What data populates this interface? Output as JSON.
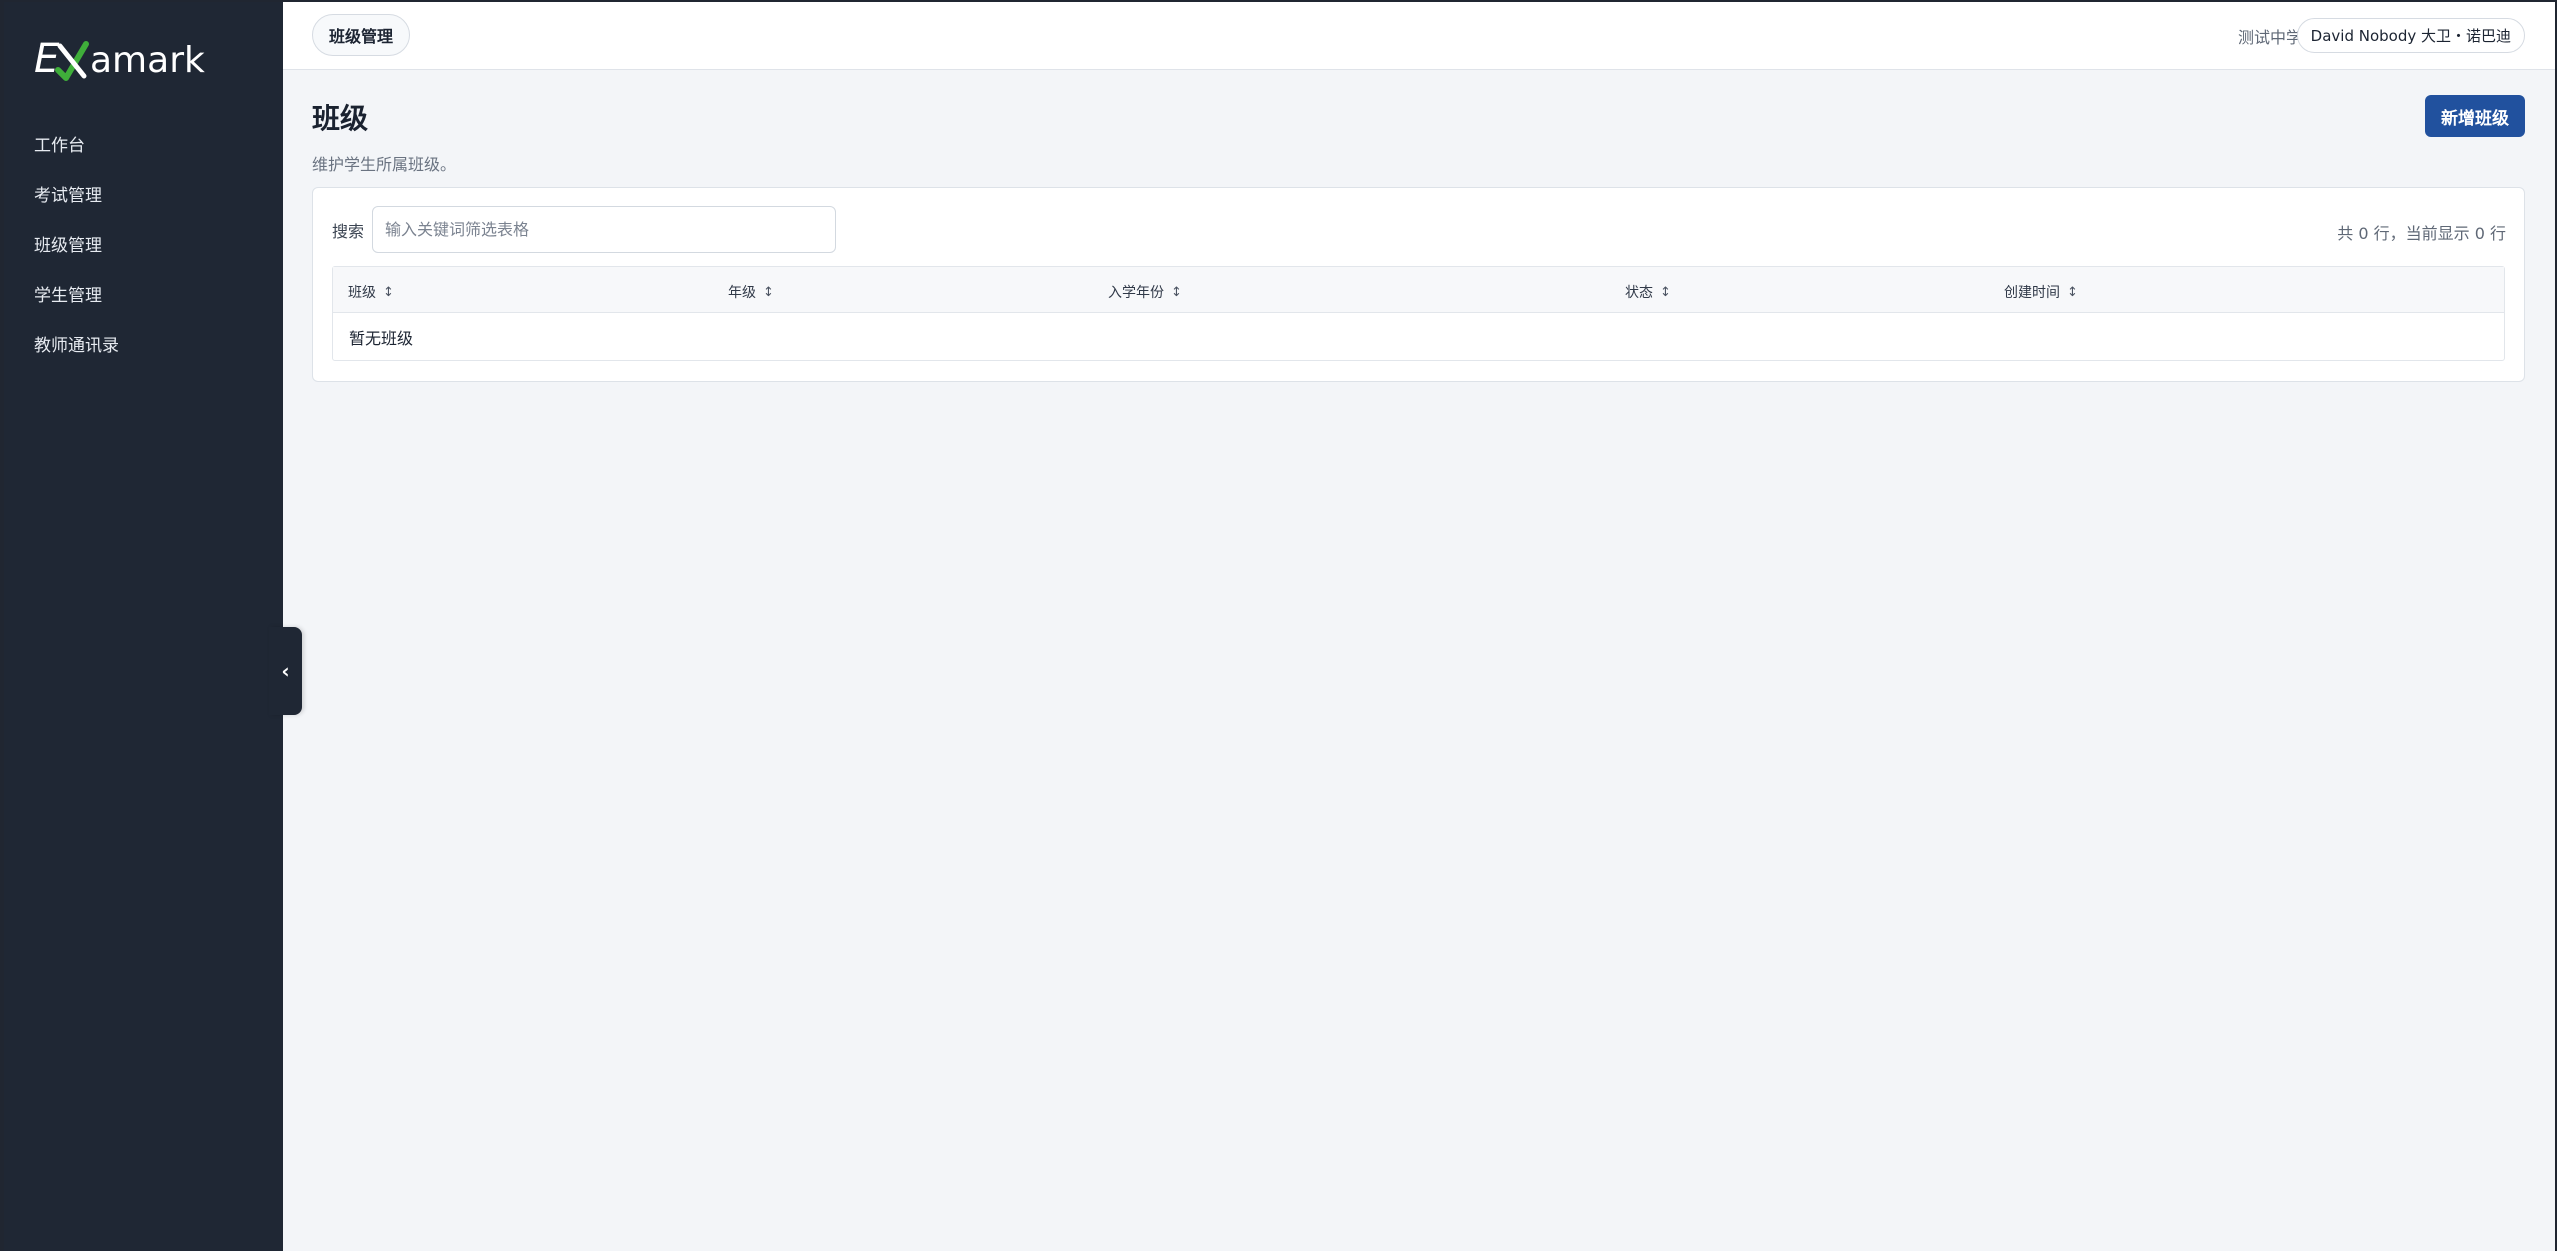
{
  "sidebar": {
    "logo_text": "Examark",
    "items": [
      {
        "label": "工作台"
      },
      {
        "label": "考试管理"
      },
      {
        "label": "班级管理"
      },
      {
        "label": "学生管理"
      },
      {
        "label": "教师通讯录"
      }
    ],
    "collapse_glyph": "‹"
  },
  "topbar": {
    "breadcrumb": "班级管理",
    "school": "测试中学",
    "user": "David Nobody 大卫・诺巴迪"
  },
  "page": {
    "title": "班级",
    "subtitle": "维护学生所属班级。",
    "add_button": "新增班级"
  },
  "search": {
    "label": "搜索",
    "placeholder": "输入关键词筛选表格",
    "value": ""
  },
  "table": {
    "row_count": "共 0 行，当前显示 0 行",
    "columns": [
      {
        "label": "班级"
      },
      {
        "label": "年级"
      },
      {
        "label": "入学年份"
      },
      {
        "label": "状态"
      },
      {
        "label": "创建时间"
      }
    ],
    "sort_glyph": "↕",
    "empty": "暂无班级"
  },
  "colors": {
    "sidebar_bg": "#1f2734",
    "primary": "#21519e",
    "logo_check": "#3fae3a"
  }
}
